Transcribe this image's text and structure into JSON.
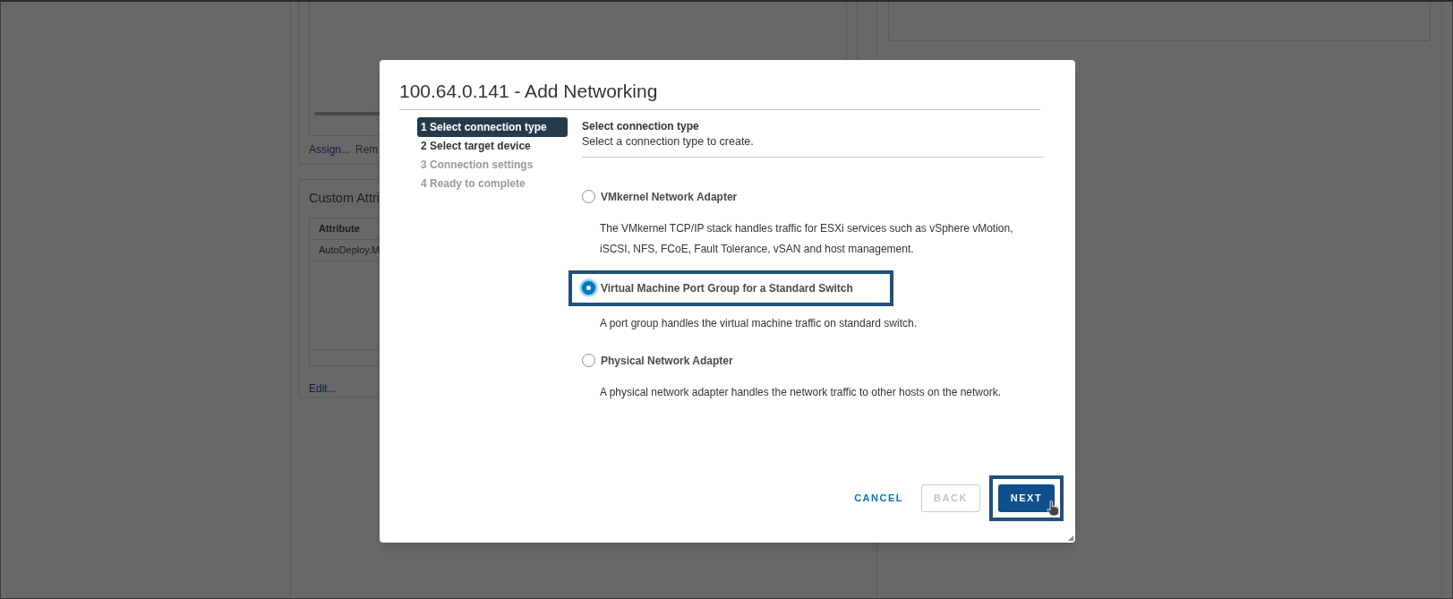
{
  "background": {
    "links": [
      "Assign...",
      "Rem"
    ],
    "panel_title": "Custom Attri",
    "table": {
      "columns": [
        "Attribute"
      ],
      "rows": [
        [
          "AutoDeploy.M"
        ]
      ]
    },
    "edit_link": "Edit..."
  },
  "dialog": {
    "title": "100.64.0.141 - Add Networking",
    "steps": [
      {
        "label": "1 Select connection type",
        "selected": true,
        "disabled": false
      },
      {
        "label": "2 Select target device",
        "selected": false,
        "disabled": false
      },
      {
        "label": "3 Connection settings",
        "selected": false,
        "disabled": true
      },
      {
        "label": "4 Ready to complete",
        "selected": false,
        "disabled": true
      }
    ],
    "heading": "Select connection type",
    "subheading": "Select a connection type to create.",
    "options": [
      {
        "label": "VMkernel Network Adapter",
        "description": "The VMkernel TCP/IP stack handles traffic for ESXi services such as vSphere vMotion, iSCSI, NFS, FCoE, Fault Tolerance, vSAN and host management.",
        "selected": false,
        "highlighted": false
      },
      {
        "label": "Virtual Machine Port Group for a Standard Switch",
        "description": "A port group handles the virtual machine traffic on standard switch.",
        "selected": true,
        "highlighted": true
      },
      {
        "label": "Physical Network Adapter",
        "description": "A physical network adapter handles the network traffic to other hosts on the network.",
        "selected": false,
        "highlighted": false
      }
    ],
    "buttons": [
      {
        "label": "CANCEL",
        "kind": "link",
        "disabled": false,
        "highlighted": false
      },
      {
        "label": "BACK",
        "kind": "outline",
        "disabled": true,
        "highlighted": false
      },
      {
        "label": "NEXT",
        "kind": "primary",
        "disabled": false,
        "highlighted": true
      }
    ]
  }
}
